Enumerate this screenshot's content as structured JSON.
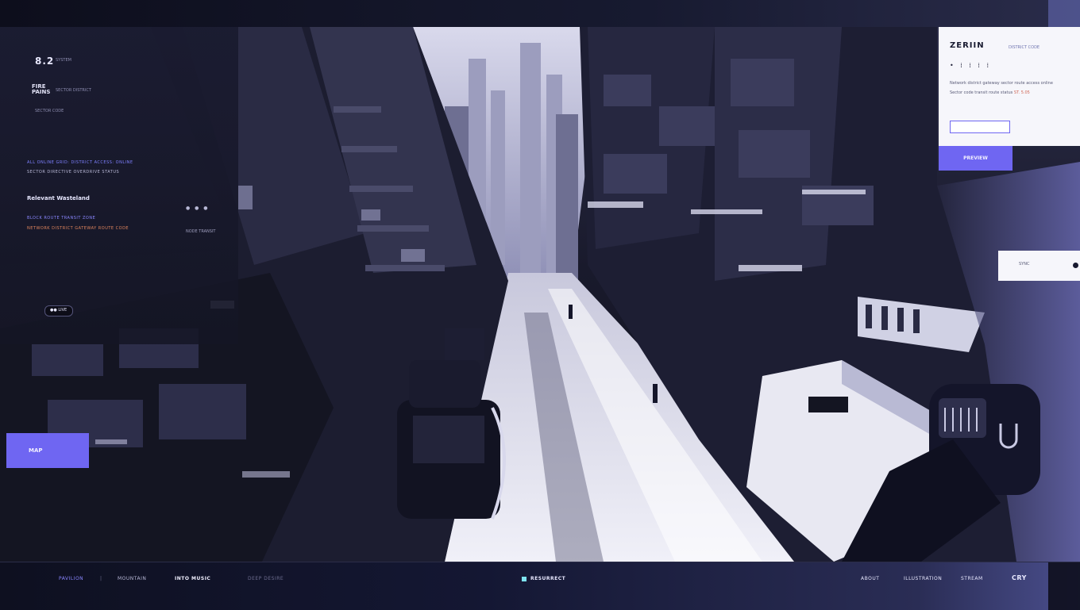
{
  "left_panel": {
    "number": "8.2",
    "number_sub": "SYSTEM",
    "title": "FIRE PAINS",
    "title_sub": "SECTOR DISTRICT",
    "meta": "SECTOR CODE",
    "line1": "ALL ONLINE GRID: DISTRICT ACCESS: ONLINE",
    "line2": "SECTOR DIRECTIVE OVERDRIVE STATUS",
    "section": "Relevant Wasteland",
    "line3": "BLOCK ROUTE TRANSIT ZONE",
    "line4": "NETWORK DISTRICT GATEWAY ROUTE CODE",
    "icons": "● ● ●",
    "time": "NODE TRANSIT",
    "badge": "●● LIVE",
    "button": "MAP"
  },
  "right_panel": {
    "title": "ZERIIN",
    "tag": "DISTRICT CODE",
    "dots": "• ⁞ ⁞ ⁞ ⁞",
    "text1": "Network district gateway sector route access online",
    "text2": "Sector code transit route status",
    "text2_accent": "ST. 5.05",
    "input_value": "",
    "button": "PREVIEW"
  },
  "toast": {
    "text": "SYNC"
  },
  "bottom_bar": {
    "item1": "PAVILION",
    "separator": "|",
    "item2": "MOUNTAIN",
    "item3": "INTO MUSIC",
    "item4": "DEEP DESIRE",
    "center": "RESURRECT",
    "item5": "ABOUT",
    "item6": "ILLUSTRATION",
    "item7": "STREAM",
    "item8": "CRY"
  },
  "colors": {
    "accent": "#6f66f2",
    "panel": "#f6f6fb",
    "dark": "#0c0d1a"
  }
}
